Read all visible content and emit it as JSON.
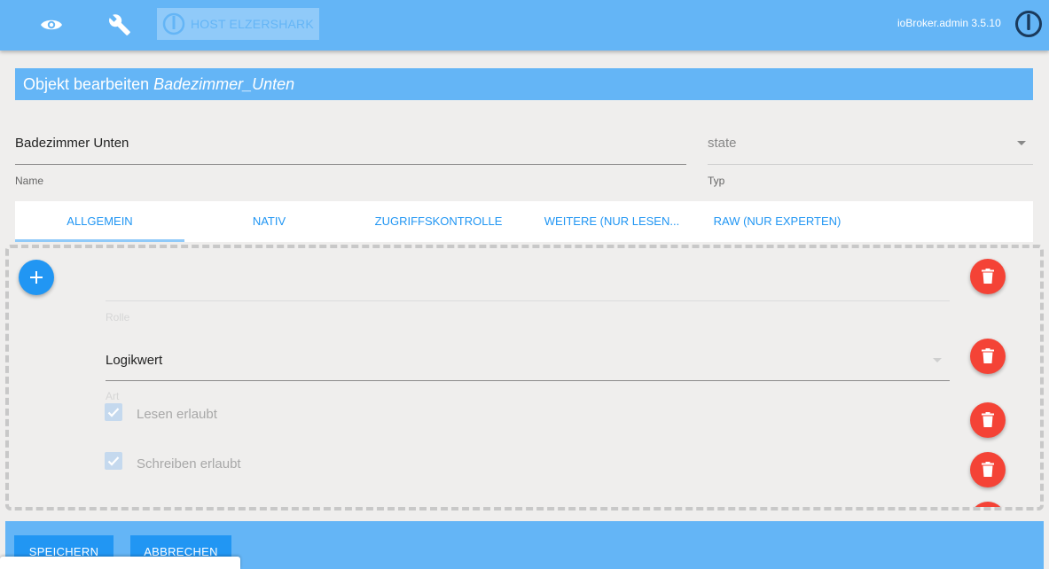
{
  "header": {
    "view_icon": "eye-icon",
    "settings_icon": "wrench-icon",
    "host_label": "HOST ELZERSHARK",
    "admin_version": "ioBroker.admin 3.5.10",
    "accent_color": "#64b5f6"
  },
  "title": {
    "prefix": "Objekt bearbeiten",
    "object_id": "Badezimmer_Unten"
  },
  "form": {
    "name_value": "Badezimmer Unten",
    "name_label": "Name",
    "type_value": "state",
    "type_label": "Typ"
  },
  "tabs": [
    {
      "label": "ALLGEMEIN",
      "active": true
    },
    {
      "label": "NATIV"
    },
    {
      "label": "ZUGRIFFSKONTROLLE"
    },
    {
      "label": "WEITERE (NUR LESEN..."
    },
    {
      "label": "RAW (NUR EXPERTEN)"
    }
  ],
  "general": {
    "rolle_value": "",
    "rolle_label": "Rolle",
    "art_value": "Logikwert",
    "art_label": "Art",
    "read_label": "Lesen erlaubt",
    "read_checked": true,
    "write_label": "Schreiben erlaubt",
    "write_checked": true
  },
  "footer": {
    "save_label": "SPEICHERN",
    "cancel_label": "ABBRECHEN"
  },
  "colors": {
    "primary": "#2196f3",
    "danger": "#f44336",
    "header": "#64b5f6"
  }
}
